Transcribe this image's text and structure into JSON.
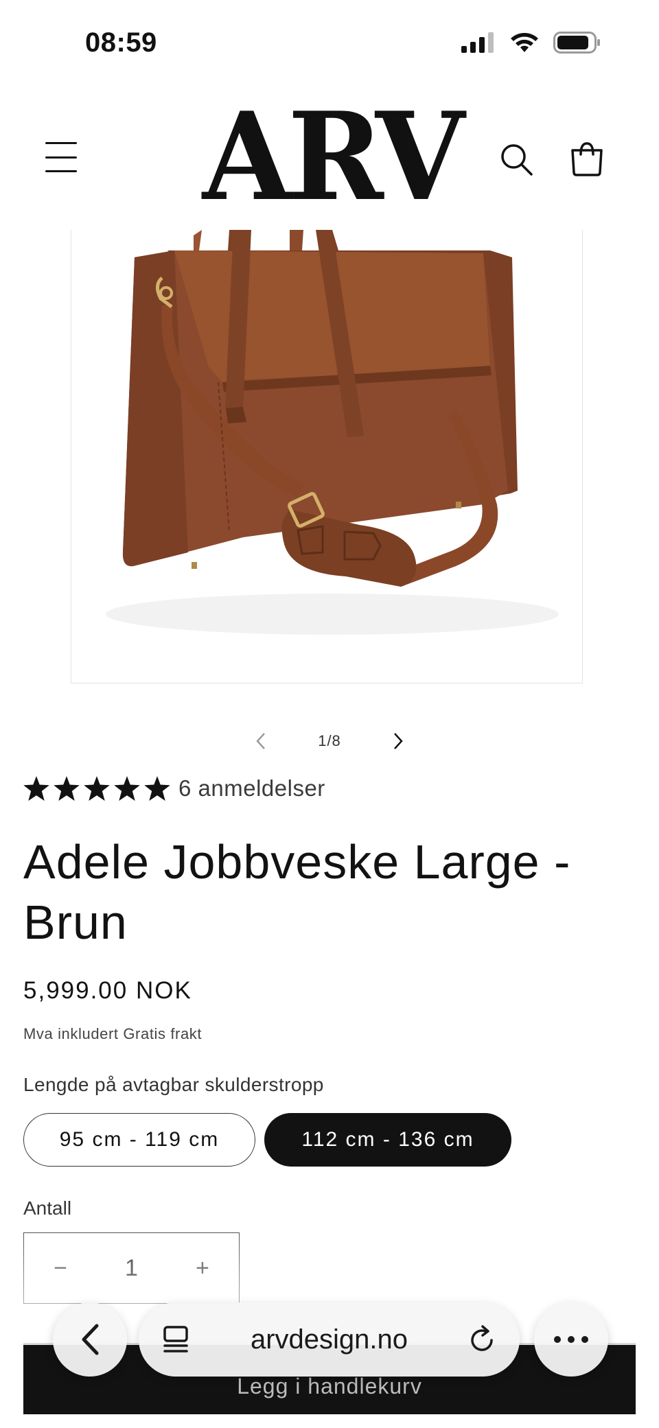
{
  "status_bar": {
    "time": "08:59"
  },
  "header": {
    "logo_text": "ARV"
  },
  "slider": {
    "counter": "1/8"
  },
  "product": {
    "rating": 5,
    "reviews": "6 anmeldelser",
    "title": "Adele Jobbveske Large - Brun",
    "price": "5,999.00 NOK",
    "tax_note": "Mva inkludert Gratis frakt",
    "variant_label": "Lengde på avtagbar skulderstropp",
    "variants": [
      {
        "label": "95 cm - 119 cm",
        "selected": false
      },
      {
        "label": "112 cm - 136 cm",
        "selected": true
      }
    ],
    "quantity_label": "Antall",
    "quantity": "1",
    "quantity_minus": "−",
    "quantity_plus": "+",
    "add_to_cart": "Legg i handlekurv"
  },
  "browser": {
    "url": "arvdesign.no"
  },
  "colors": {
    "accent": "#121212",
    "bag": "#8b4a2e",
    "background": "#ffffff"
  }
}
